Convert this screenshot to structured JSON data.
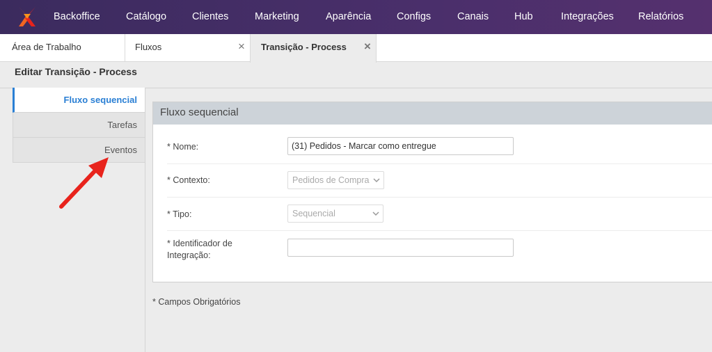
{
  "nav": {
    "items": [
      "Backoffice",
      "Catálogo",
      "Clientes",
      "Marketing",
      "Aparência",
      "Configs",
      "Canais",
      "Hub",
      "Integrações",
      "Relatórios"
    ]
  },
  "tabs": [
    {
      "label": "Área de Trabalho"
    },
    {
      "label": "Fluxos",
      "close": "×"
    },
    {
      "label": "Transição - Process",
      "close": "×"
    }
  ],
  "page": {
    "title": "Editar Transição - Process"
  },
  "leftmenu": {
    "items": [
      "Fluxo sequencial",
      "Tarefas",
      "Eventos"
    ]
  },
  "panel": {
    "title": "Fluxo sequencial",
    "fields": {
      "nome": {
        "label": "* Nome:",
        "value": "(31) Pedidos - Marcar como entregue"
      },
      "contexto": {
        "label": "* Contexto:",
        "value": "Pedidos de Compra"
      },
      "tipo": {
        "label": "* Tipo:",
        "value": "Sequencial"
      },
      "identificador": {
        "label_line1": "* Identificador de",
        "label_line2": "Integração:",
        "value": ""
      }
    }
  },
  "footer": {
    "required_note": "* Campos Obrigatórios"
  },
  "colors": {
    "nav_bg": "#4a2f6b",
    "accent": "#2a7fd4",
    "annotation_arrow": "#e8231c"
  }
}
